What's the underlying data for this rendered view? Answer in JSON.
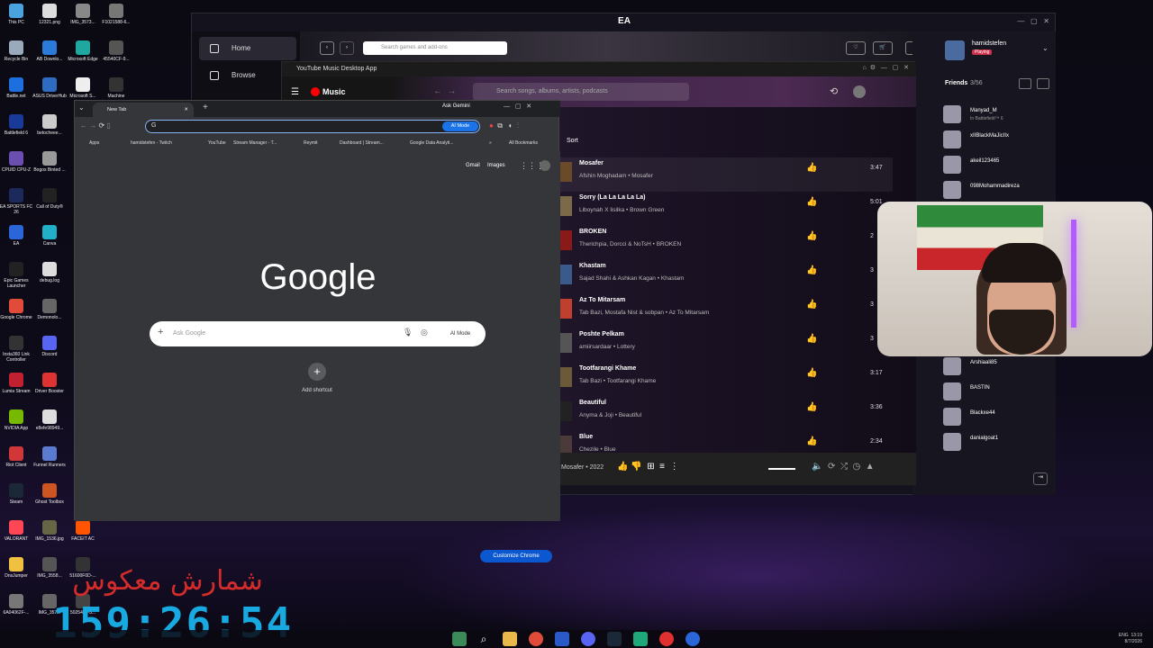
{
  "desktop": {
    "icons": [
      {
        "label": "This PC",
        "color": "#4aa3df"
      },
      {
        "label": "12321.png",
        "color": "#ddd"
      },
      {
        "label": "IMG_3573...",
        "color": "#888"
      },
      {
        "label": "F1021588-6...",
        "color": "#777"
      },
      {
        "label": "Recycle Bin",
        "color": "#9ab"
      },
      {
        "label": "AB Downlo...",
        "color": "#2b7bd9"
      },
      {
        "label": "Microsoft Edge",
        "color": "#1fa8a0"
      },
      {
        "label": "45540CF-9...",
        "color": "#555"
      },
      {
        "label": "Battle.net",
        "color": "#1d6fe0"
      },
      {
        "label": "ASUS DriverHub",
        "color": "#2d6cc0"
      },
      {
        "label": "Microsoft S...",
        "color": "#eee"
      },
      {
        "label": "Machine",
        "color": "#333"
      },
      {
        "label": "Battlefield 6",
        "color": "#1a3a9a"
      },
      {
        "label": "betocheee...",
        "color": "#ccc"
      },
      {
        "label": "CPUID CPU-Z",
        "color": "#6a4fb0"
      },
      {
        "label": "Bogos Binted ...",
        "color": "#999"
      },
      {
        "label": "EA SPORTS FC 26",
        "color": "#1b2a5a"
      },
      {
        "label": "Call of Duty®",
        "color": "#222"
      },
      {
        "label": "EA",
        "color": "#2a66d8"
      },
      {
        "label": "Canva",
        "color": "#22b0c8"
      },
      {
        "label": "Epic Games Launcher",
        "color": "#222"
      },
      {
        "label": "debug.log",
        "color": "#ddd"
      },
      {
        "label": "Google Chrome",
        "color": "#e04b3a"
      },
      {
        "label": "Demonolo...",
        "color": "#666"
      },
      {
        "label": "Insta360 Link Controller",
        "color": "#333"
      },
      {
        "label": "Discord",
        "color": "#5865f2"
      },
      {
        "label": "Lumia Stream",
        "color": "#c02030"
      },
      {
        "label": "Driver Booster",
        "color": "#d33"
      },
      {
        "label": "NVIDIA App",
        "color": "#76b900"
      },
      {
        "label": "e8efe98949...",
        "color": "#ddd"
      },
      {
        "label": "Riot Client",
        "color": "#d13639"
      },
      {
        "label": "Funnel Runners",
        "color": "#5b7bd0"
      },
      {
        "label": "Steam",
        "color": "#1b2838"
      },
      {
        "label": "Ghost Toolbox",
        "color": "#c52"
      },
      {
        "label": "VALORANT",
        "color": "#ff4655"
      },
      {
        "label": "IMG_1536.jpg",
        "color": "#664"
      },
      {
        "label": "FACEIT AC",
        "color": "#ff5500"
      },
      {
        "label": "DnsJumper",
        "color": "#f0c040"
      },
      {
        "label": "IMG_3558...",
        "color": "#555"
      },
      {
        "label": "51600F0D-...",
        "color": "#333"
      },
      {
        "label": "6A04062F-...",
        "color": "#777"
      },
      {
        "label": "IMG_357...",
        "color": "#666"
      },
      {
        "label": "5025464-5...",
        "color": "#444"
      }
    ]
  },
  "countdown": {
    "title": "شمارش معکوس",
    "time": "159:26:54"
  },
  "ea": {
    "title": "EA",
    "nav": [
      {
        "label": "Home"
      },
      {
        "label": "Browse"
      }
    ],
    "search_placeholder": "Search games and add-ons",
    "cart_count": "0",
    "user": {
      "name": "hamidstefen",
      "status": "Playing"
    },
    "friends_title": "Friends",
    "friends_count": "3/56",
    "friends": [
      {
        "name": "Manyad_M",
        "status": "In Battlefield™ 6"
      },
      {
        "name": "xIIBlackMaJicIIx",
        "status": ""
      },
      {
        "name": "akeil123465",
        "status": ""
      },
      {
        "name": "098Mohammadireza",
        "status": ""
      },
      {
        "name": "Arshiaali85",
        "status": ""
      },
      {
        "name": "BASTIN",
        "status": ""
      },
      {
        "name": "Blackxe44",
        "status": ""
      },
      {
        "name": "danialgoat1",
        "status": ""
      }
    ]
  },
  "ytmusic": {
    "window_title": "YouTube Music Desktop App",
    "logo": "Music",
    "search_placeholder": "Search songs, albums, artists, podcasts",
    "sort_label": "Sort",
    "songs": [
      {
        "title": "Mosafer",
        "artist": "Afshin Moghadam • Mosafer",
        "duration": "3:47",
        "thumb": "#6b4a2a"
      },
      {
        "title": "Sorry (La La La La La)",
        "artist": "Liboynah X lisilka • Brown Green",
        "duration": "5:01",
        "thumb": "#7a6a4a"
      },
      {
        "title": "BROKEN",
        "artist": "Therichpia, Dorcci & NoTsH • BROKEN",
        "duration": "2",
        "thumb": "#8a1a1a"
      },
      {
        "title": "Khastam",
        "artist": "Sajad Shahi & Ashkan Kagan • Khastam",
        "duration": "3",
        "thumb": "#3a5a8a"
      },
      {
        "title": "Az To Mitarsam",
        "artist": "Tab Bazi, Mostafa Nist & sobpan • Az To Mitarsam",
        "duration": "3",
        "thumb": "#c04030"
      },
      {
        "title": "Poshte Pelkam",
        "artist": "amiirsardaar • Lottery",
        "duration": "3",
        "thumb": "#555"
      },
      {
        "title": "Tootfarangi Khame",
        "artist": "Tab Bazi • Tootfarangi Khame",
        "duration": "3:17",
        "thumb": "#6a5a3a"
      },
      {
        "title": "Beautiful",
        "artist": "Anyma & Joji • Beautiful",
        "duration": "3:36",
        "thumb": "#222"
      },
      {
        "title": "Blue",
        "artist": "Chezile • Blue",
        "duration": "2:34",
        "thumb": "#4a3a3a"
      }
    ],
    "player": {
      "now_playing": "Mosafer • 2022"
    }
  },
  "chrome": {
    "tab_title": "New Tab",
    "ask_gemini": "Ask Gemini",
    "omni_ai_mode": "AI Mode",
    "bookmarks": [
      "Apps",
      "hamidstefen - Twitch",
      "YouTube",
      "Stream Manager - T...",
      "Reymit",
      "Dashboard | Stream...",
      "Google Data Analyti..."
    ],
    "all_bookmarks": "All Bookmarks",
    "top_links": [
      "Gmail",
      "Images"
    ],
    "logo": "Google",
    "search_placeholder": "Ask Google",
    "ai_mode": "AI Mode",
    "shortcut_label": "Add shortcut",
    "customize": "Customize Chrome"
  },
  "taskbar": {
    "lang": "ENG",
    "time": "13:19",
    "date": "8/7/2026"
  }
}
